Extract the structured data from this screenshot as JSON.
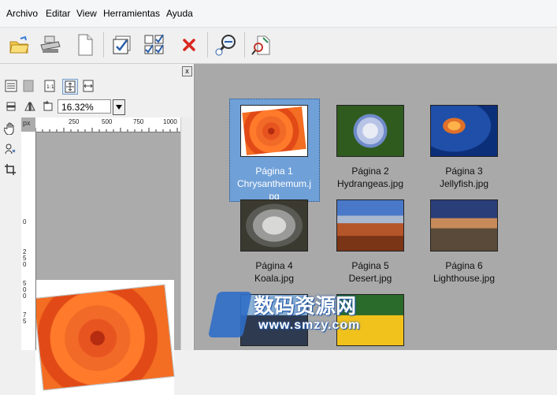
{
  "menu": [
    "Archivo",
    "Editar",
    "View",
    "Herramientas",
    "Ayuda"
  ],
  "toolbar": {
    "buttons": [
      "open-folder",
      "scanner",
      "new-page",
      "check-page",
      "check-all",
      "delete",
      "zoom",
      "export"
    ]
  },
  "left_panel": {
    "close_label": "x",
    "zoom_value": "16.32%",
    "ruler_unit": "px",
    "hruler_ticks": [
      "250",
      "500",
      "750",
      "1000"
    ],
    "vruler_ticks": [
      "0",
      "2",
      "5",
      "0",
      "5",
      "0",
      "0",
      "7",
      "5"
    ]
  },
  "thumbnails": [
    {
      "line1": "Página 1",
      "line2": "Chrysanthemum.j",
      "line3": "pg",
      "selected": true
    },
    {
      "line1": "Página 2",
      "line2": "Hydrangeas.jpg",
      "line3": "",
      "selected": false
    },
    {
      "line1": "Página 3",
      "line2": "Jellyfish.jpg",
      "line3": "",
      "selected": false
    },
    {
      "line1": "Página 4",
      "line2": "Koala.jpg",
      "line3": "",
      "selected": false
    },
    {
      "line1": "Página 5",
      "line2": "Desert.jpg",
      "line3": "",
      "selected": false
    },
    {
      "line1": "Página 6",
      "line2": "Lighthouse.jpg",
      "line3": "",
      "selected": false
    }
  ],
  "watermark": {
    "line1": "数码资源网",
    "line2": "www.smzy.com"
  },
  "colors": {
    "selection": "#6fa0d8",
    "viewer_bg": "#a9a9a9"
  }
}
